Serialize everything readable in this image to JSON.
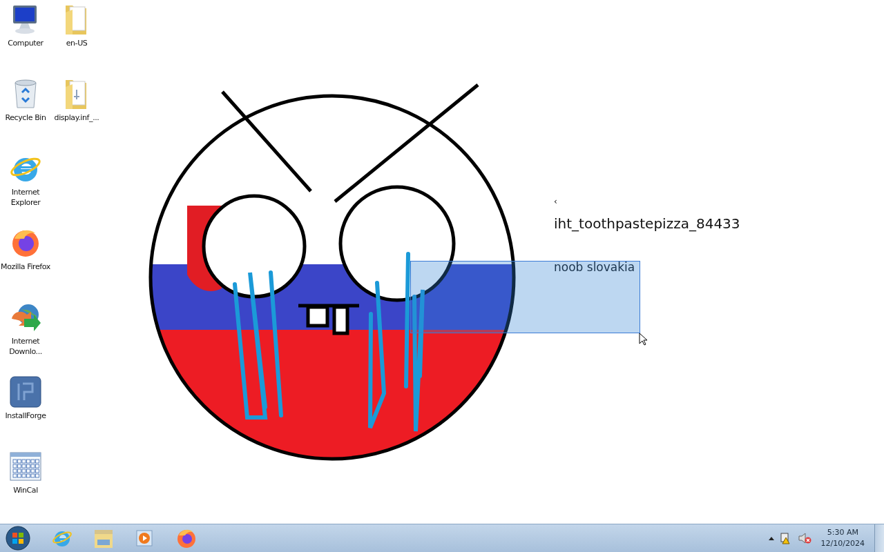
{
  "desktop_icons": [
    {
      "kind": "computer",
      "label": "Computer",
      "selected": false
    },
    {
      "kind": "recycle-bin",
      "label": "Recycle Bin",
      "selected": false
    },
    {
      "kind": "ie",
      "label": "Internet Explorer",
      "selected": false
    },
    {
      "kind": "firefox",
      "label": "Mozilla Firefox",
      "selected": false
    },
    {
      "kind": "downloader",
      "label": "Internet Downlo...",
      "selected": false
    },
    {
      "kind": "installforge",
      "label": "InstallForge",
      "selected": false
    },
    {
      "kind": "calendar",
      "label": "WinCal",
      "selected": false
    },
    {
      "kind": "folder",
      "label": "en-US",
      "selected": false
    },
    {
      "kind": "folder-doc",
      "label": "display.inf_...",
      "selected": false
    }
  ],
  "wallpaper": {
    "texts": [
      {
        "kind": "small",
        "text": "‹"
      },
      {
        "kind": "name",
        "text": "iht_toothpastepizza_84433"
      },
      {
        "kind": "caption",
        "text": "noob slovakia"
      }
    ]
  },
  "drag_selection": true,
  "taskbar": {
    "pinned": [
      {
        "kind": "ie"
      },
      {
        "kind": "explorer"
      },
      {
        "kind": "media"
      },
      {
        "kind": "firefox"
      }
    ],
    "tray": {
      "network_warning": true,
      "sound_muted": true
    },
    "clock": {
      "time": "5:30 AM",
      "date": "12/10/2024"
    }
  }
}
